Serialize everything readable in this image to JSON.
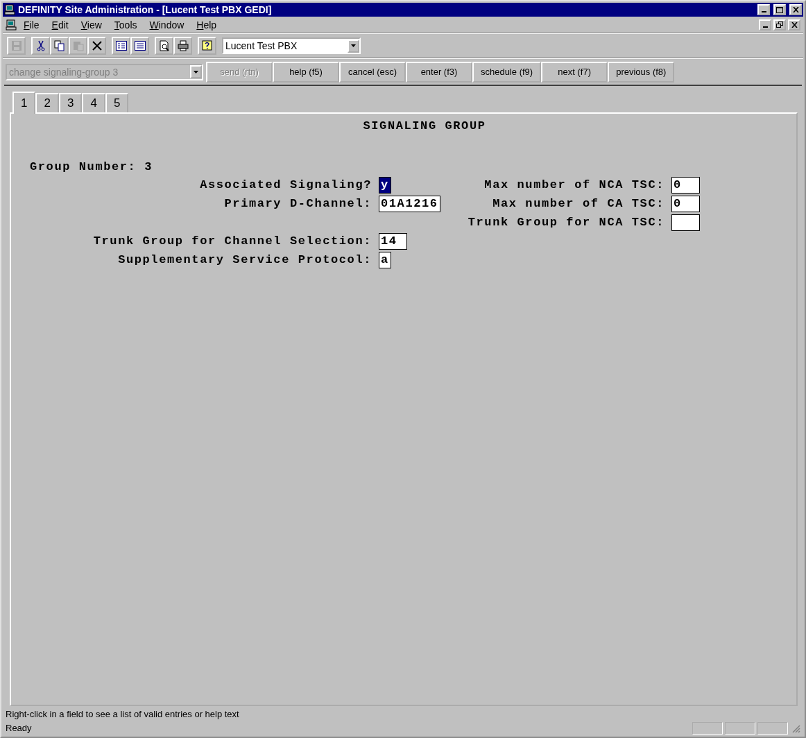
{
  "window": {
    "title": "DEFINITY Site Administration - [Lucent Test PBX GEDI]"
  },
  "menu": [
    {
      "label": "File"
    },
    {
      "label": "Edit"
    },
    {
      "label": "View"
    },
    {
      "label": "Tools"
    },
    {
      "label": "Window"
    },
    {
      "label": "Help"
    }
  ],
  "toolbar": {
    "buttons": [
      {
        "kind": "save",
        "disabled": true
      },
      {
        "kind": "cut",
        "disabled": false
      },
      {
        "kind": "copy",
        "disabled": false
      },
      {
        "kind": "paste",
        "disabled": true
      },
      {
        "kind": "delete",
        "disabled": false
      },
      {
        "kind": "form",
        "disabled": false
      },
      {
        "kind": "list",
        "disabled": false
      },
      {
        "kind": "preview",
        "disabled": false
      },
      {
        "kind": "print",
        "disabled": false
      },
      {
        "kind": "help",
        "disabled": false
      }
    ],
    "system": {
      "value": "Lucent Test PBX"
    }
  },
  "command_bar": {
    "command": {
      "value": "change signaling-group 3",
      "disabled": true
    },
    "buttons": [
      {
        "label": "send (rtn)",
        "disabled": true
      },
      {
        "label": "help (f5)",
        "disabled": false
      },
      {
        "label": "cancel (esc)",
        "disabled": false
      },
      {
        "label": "enter (f3)",
        "disabled": false
      },
      {
        "label": "schedule (f9)",
        "disabled": false
      },
      {
        "label": "next (f7)",
        "disabled": false
      },
      {
        "label": "previous (f8)",
        "disabled": false
      }
    ]
  },
  "tabs": [
    {
      "label": "1",
      "selected": true
    },
    {
      "label": "2",
      "selected": false
    },
    {
      "label": "3",
      "selected": false
    },
    {
      "label": "4",
      "selected": false
    },
    {
      "label": "5",
      "selected": false
    }
  ],
  "form": {
    "title": "SIGNALING GROUP",
    "group_number": "Group Number: 3",
    "rows": [
      {
        "left": {
          "label": "Associated Signaling?",
          "value": "y",
          "kind": "flag",
          "focused": true
        },
        "right": {
          "label": "Max number of NCA TSC:",
          "value": "0",
          "kind": "text",
          "focused": false
        }
      },
      {
        "left": {
          "label": "Primary D-Channel:",
          "value": "01A1216",
          "kind": "text",
          "focused": false
        },
        "right": {
          "label": "Max number of CA TSC:",
          "value": "0",
          "kind": "text",
          "focused": false
        }
      },
      {
        "right": {
          "label": "Trunk Group for NCA TSC:",
          "kind": "text",
          "focused": false
        }
      },
      {
        "left": {
          "label": "Trunk Group for Channel Selection:",
          "value": "14",
          "kind": "text",
          "focused": false
        }
      },
      {
        "left": {
          "label": "Supplementary Service Protocol:",
          "value": "a",
          "kind": "flag",
          "focused": false
        }
      }
    ]
  },
  "status_bar": {
    "hint": "Right-click in a field to see a list of valid entries or help text",
    "state": "Ready"
  }
}
